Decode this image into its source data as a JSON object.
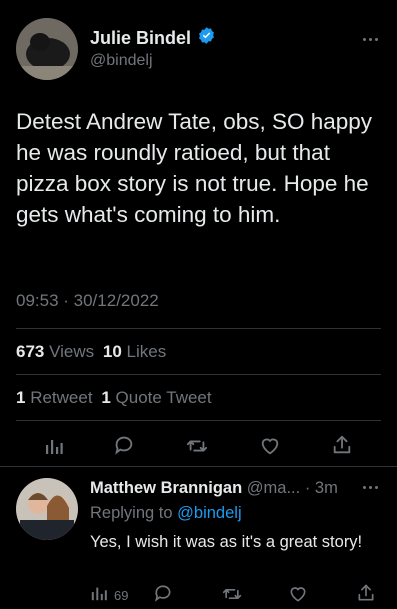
{
  "main_tweet": {
    "author_name": "Julie Bindel",
    "author_handle": "@bindelj",
    "text": "Detest Andrew Tate, obs, SO happy he was roundly ratioed, but that pizza box story is not true. Hope he gets what's coming to him.",
    "timestamp": "09:53 · 30/12/2022",
    "views_count": "673",
    "views_label": "Views",
    "likes_count": "10",
    "likes_label": "Likes",
    "retweets_count": "1",
    "retweets_label": "Retweet",
    "quotes_count": "1",
    "quotes_label": "Quote Tweet"
  },
  "reply": {
    "author_name": "Matthew Brannigan",
    "author_handle": "@ma...",
    "time": "· 3m",
    "replying_prefix": "Replying to",
    "replying_handle": "@bindelj",
    "text": "Yes, I wish it was as it's a great story!",
    "views_count": "69"
  },
  "colors": {
    "background": "#000000",
    "text": "#e7e9ea",
    "muted": "#71767b",
    "accent": "#1d9bf0",
    "divider": "#2f3336"
  },
  "icons": [
    "verified-badge-icon",
    "more-icon",
    "analytics-icon",
    "reply-icon",
    "retweet-icon",
    "like-icon",
    "share-icon"
  ]
}
